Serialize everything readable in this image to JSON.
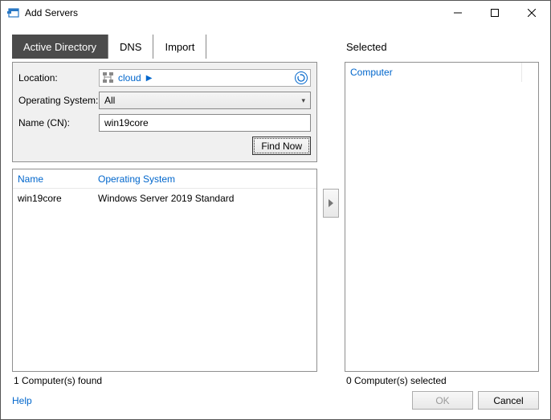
{
  "window": {
    "title": "Add Servers"
  },
  "tabs": {
    "active_directory": "Active Directory",
    "dns": "DNS",
    "import": "Import"
  },
  "filters": {
    "location_label": "Location:",
    "location_value": "cloud",
    "os_label": "Operating System:",
    "os_value": "All",
    "name_label": "Name (CN):",
    "name_value": "win19core",
    "find_now": "Find Now"
  },
  "results": {
    "header_name": "Name",
    "header_os": "Operating System",
    "rows": [
      {
        "name": "win19core",
        "os": "Windows Server 2019 Standard"
      }
    ]
  },
  "selected": {
    "label": "Selected",
    "header_computer": "Computer"
  },
  "status": {
    "found": "1 Computer(s) found",
    "selected": "0 Computer(s) selected"
  },
  "footer": {
    "help": "Help",
    "ok": "OK",
    "cancel": "Cancel"
  }
}
